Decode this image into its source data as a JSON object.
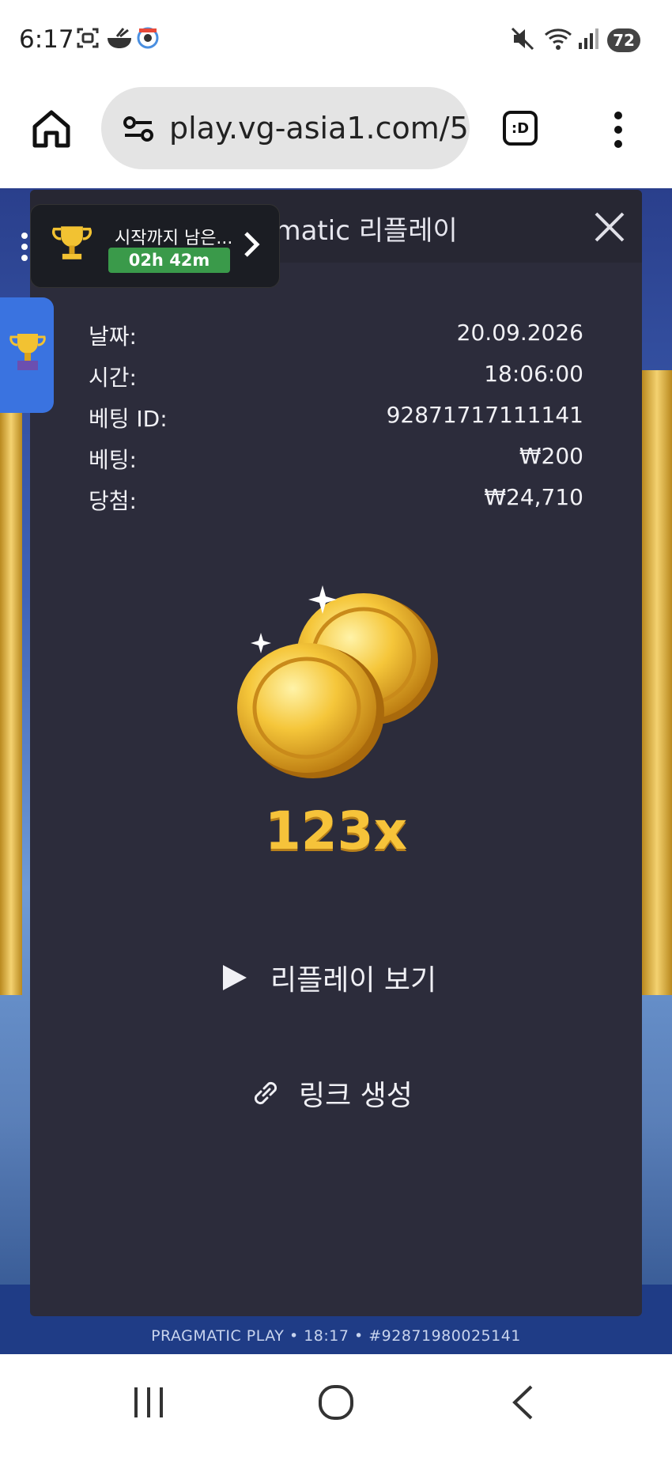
{
  "status_bar": {
    "time": "6:17",
    "battery": "72",
    "icons": [
      "screenshot-icon",
      "bowl-icon",
      "location-pin-icon",
      "mute-icon",
      "wifi-icon",
      "signal-icon"
    ]
  },
  "browser": {
    "url": "play.vg-asia1.com/5",
    "tabs_label": ":D",
    "icons": [
      "home-icon",
      "site-settings-icon",
      "tabs-icon",
      "overflow-menu-icon"
    ]
  },
  "tournament_widget": {
    "title": "시작까지 남은...",
    "timer": "02h 42m",
    "icons": [
      "trophy-icon",
      "chevron-right-icon",
      "more-vertical-icon"
    ]
  },
  "modal": {
    "title": "Pragmatic 리플레이",
    "details": [
      {
        "label": "날짜:",
        "value": "20.09.2026"
      },
      {
        "label": "시간:",
        "value": "18:06:00"
      },
      {
        "label": "베팅 ID:",
        "value": "92871717111141"
      },
      {
        "label": "베팅:",
        "value": "₩200"
      },
      {
        "label": "당첨:",
        "value": "₩24,710"
      }
    ],
    "multiplier": "123x",
    "replay_label": "리플레이 보기",
    "link_label": "링크 생성",
    "icons": [
      "close-icon",
      "coins-icon",
      "play-icon",
      "link-icon"
    ]
  },
  "game_footer": {
    "text": "PRAGMATIC PLAY • 18:17 • #92871980025141"
  },
  "colors": {
    "modal_bg": "#2c2c3b",
    "multiplier": "#f6c33a",
    "timer_badge": "#3a9a4a"
  }
}
